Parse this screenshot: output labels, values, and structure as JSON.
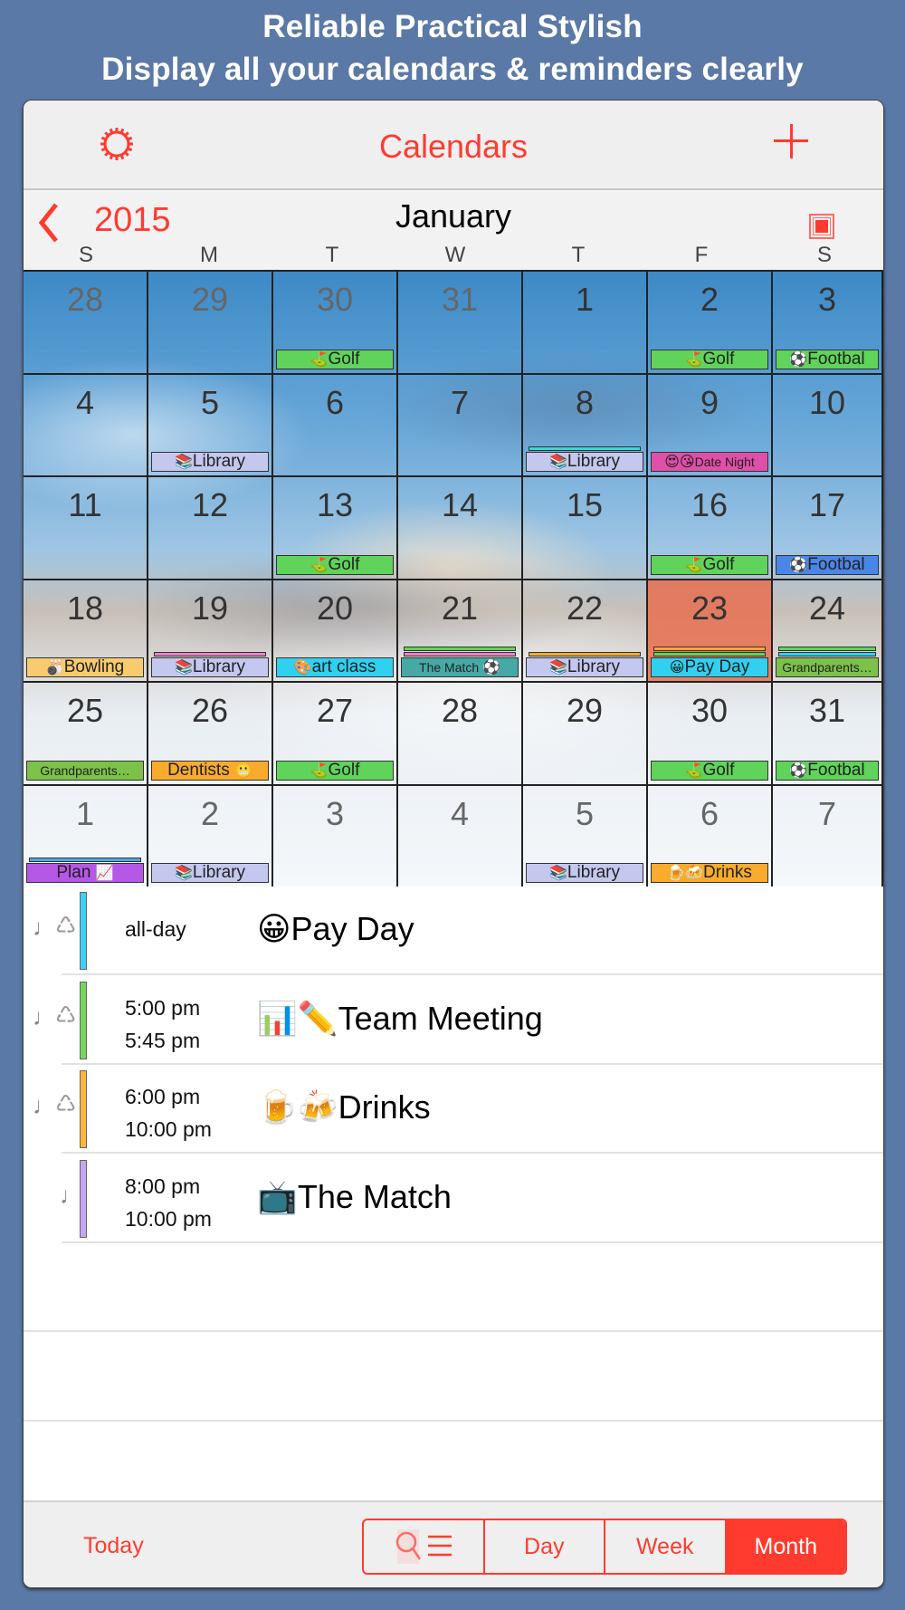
{
  "promo": {
    "line1": "Reliable Practical Stylish",
    "line2": "Display all your calendars & reminders clearly"
  },
  "navbar": {
    "settings_icon": "gear-icon",
    "title": "Calendars",
    "add_icon": "plus-icon"
  },
  "month_header": {
    "back_icon": "chevron-left-icon",
    "year": "2015",
    "month": "January",
    "view_toggle_icon": "square-icon",
    "weekdays": [
      "S",
      "M",
      "T",
      "W",
      "T",
      "F",
      "S"
    ]
  },
  "colors": {
    "accent": "#ff3b30",
    "background": "#5b79a6",
    "today_cell": "#e86e50",
    "golf": "#5fd35a",
    "library": "#c4c8ef",
    "football_green": "#5fd35a",
    "football_blue": "#4a86e8",
    "date_night": "#e04fa8",
    "bowling": "#f7cb6e",
    "art_class": "#2fd0f0",
    "the_match": "#46a9a6",
    "pay_day": "#2fd0f0",
    "grandparents": "#7cc24a",
    "dentists": "#f8ab2c",
    "plan": "#b558e6",
    "drinks": "#f8ab2c"
  },
  "calendar": {
    "weeks": [
      [
        {
          "day": "28",
          "other": true,
          "events": []
        },
        {
          "day": "29",
          "other": true,
          "events": []
        },
        {
          "day": "30",
          "other": true,
          "events": [
            {
              "icon": "⛳",
              "label": "Golf",
              "color": "#5fd35a"
            }
          ]
        },
        {
          "day": "31",
          "other": true,
          "events": []
        },
        {
          "day": "1",
          "events": []
        },
        {
          "day": "2",
          "events": [
            {
              "icon": "⛳",
              "label": "Golf",
              "color": "#5fd35a"
            }
          ]
        },
        {
          "day": "3",
          "events": [
            {
              "icon": "⚽",
              "label": "Footbal",
              "color": "#5fd35a"
            }
          ]
        }
      ],
      [
        {
          "day": "4",
          "events": []
        },
        {
          "day": "5",
          "events": [
            {
              "icon": "📚",
              "label": "Library",
              "color": "#c4c8ef"
            }
          ]
        },
        {
          "day": "6",
          "events": []
        },
        {
          "day": "7",
          "events": []
        },
        {
          "day": "8",
          "events": [
            {
              "icon": "📚",
              "label": "Library",
              "color": "#c4c8ef"
            }
          ],
          "stripes": [
            "#3dd6d0"
          ]
        },
        {
          "day": "9",
          "events": [
            {
              "icon": "😍😘",
              "label": "Date Night",
              "color": "#e04fa8",
              "small": true
            }
          ]
        },
        {
          "day": "10",
          "events": []
        }
      ],
      [
        {
          "day": "11",
          "events": []
        },
        {
          "day": "12",
          "events": []
        },
        {
          "day": "13",
          "events": [
            {
              "icon": "⛳",
              "label": "Golf",
              "color": "#5fd35a"
            }
          ]
        },
        {
          "day": "14",
          "events": []
        },
        {
          "day": "15",
          "events": []
        },
        {
          "day": "16",
          "events": [
            {
              "icon": "⛳",
              "label": "Golf",
              "color": "#5fd35a"
            }
          ]
        },
        {
          "day": "17",
          "events": [
            {
              "icon": "⚽",
              "label": "Footbal",
              "color": "#4a86e8"
            }
          ]
        }
      ],
      [
        {
          "day": "18",
          "events": [
            {
              "icon": "🎳",
              "label": "Bowling",
              "color": "#f7cb6e"
            }
          ]
        },
        {
          "day": "19",
          "events": [
            {
              "icon": "📚",
              "label": "Library",
              "color": "#c4c8ef"
            }
          ],
          "stripes": [
            "#f07ecb"
          ]
        },
        {
          "day": "20",
          "events": [
            {
              "icon": "🎨",
              "label": "art class",
              "color": "#2fd0f0"
            }
          ]
        },
        {
          "day": "21",
          "events": [
            {
              "icon": "⚽",
              "label": "The Match",
              "color": "#46a9a6",
              "small": true,
              "icon_after": true
            }
          ],
          "stripes": [
            "#f07ecb",
            "#5fd35a"
          ]
        },
        {
          "day": "22",
          "events": [
            {
              "icon": "📚",
              "label": "Library",
              "color": "#c4c8ef"
            }
          ],
          "stripes": [
            "#f8ab2c"
          ]
        },
        {
          "day": "23",
          "today": true,
          "events": [
            {
              "icon": "😀",
              "label": "Pay Day",
              "color": "#2fd0f0"
            }
          ],
          "stripes": [
            "#5fd35a",
            "#f8ab2c"
          ]
        },
        {
          "day": "24",
          "events": [
            {
              "icon": "",
              "label": "Grandparents…",
              "color": "#7cc24a",
              "small": true
            }
          ],
          "stripes": [
            "#2fd0f0",
            "#5fd35a"
          ]
        }
      ],
      [
        {
          "day": "25",
          "events": [
            {
              "icon": "",
              "label": "Grandparents…",
              "color": "#7cc24a",
              "small": true
            }
          ]
        },
        {
          "day": "26",
          "events": [
            {
              "icon": "😬",
              "label": "Dentists",
              "color": "#f8ab2c",
              "icon_after": true
            }
          ]
        },
        {
          "day": "27",
          "events": [
            {
              "icon": "⛳",
              "label": "Golf",
              "color": "#5fd35a"
            }
          ]
        },
        {
          "day": "28",
          "events": []
        },
        {
          "day": "29",
          "events": []
        },
        {
          "day": "30",
          "events": [
            {
              "icon": "⛳",
              "label": "Golf",
              "color": "#5fd35a"
            }
          ]
        },
        {
          "day": "31",
          "events": [
            {
              "icon": "⚽",
              "label": "Footbal",
              "color": "#5fd35a"
            }
          ]
        }
      ],
      [
        {
          "day": "1",
          "other": true,
          "events": [
            {
              "icon": "📈",
              "label": "Plan",
              "color": "#b558e6",
              "icon_after": true
            }
          ],
          "stripes": [
            "#4aa8e0"
          ]
        },
        {
          "day": "2",
          "other": true,
          "events": [
            {
              "icon": "📚",
              "label": "Library",
              "color": "#c4c8ef"
            }
          ]
        },
        {
          "day": "3",
          "other": true,
          "events": []
        },
        {
          "day": "4",
          "other": true,
          "events": []
        },
        {
          "day": "5",
          "other": true,
          "events": [
            {
              "icon": "📚",
              "label": "Library",
              "color": "#c4c8ef"
            }
          ]
        },
        {
          "day": "6",
          "other": true,
          "events": [
            {
              "icon": "🍺🍻",
              "label": "Drinks",
              "color": "#f8ab2c"
            }
          ]
        },
        {
          "day": "7",
          "other": true,
          "events": []
        }
      ]
    ]
  },
  "day_events": [
    {
      "alarm": "♩",
      "repeat": "♺",
      "color": "#3ed0f5",
      "allday": "all-day",
      "start": "",
      "end": "",
      "icon": "😀",
      "title": "Pay Day"
    },
    {
      "alarm": "♩",
      "repeat": "♺",
      "color": "#77d65e",
      "allday": "",
      "start": "5:00 pm",
      "end": "5:45 pm",
      "icon": "📊✏️",
      "title": "Team Meeting"
    },
    {
      "alarm": "♩",
      "repeat": "♺",
      "color": "#ffb640",
      "allday": "",
      "start": "6:00 pm",
      "end": "10:00 pm",
      "icon": "🍺🍻",
      "title": "Drinks"
    },
    {
      "alarm": "♩",
      "repeat": "",
      "color": "#c7a6f0",
      "allday": "",
      "start": "8:00 pm",
      "end": "10:00 pm",
      "icon": "📺",
      "title": "The Match"
    }
  ],
  "toolbar": {
    "today_label": "Today",
    "segments": [
      {
        "label": "",
        "icon": "search-list-icon",
        "active": false
      },
      {
        "label": "Day",
        "active": false
      },
      {
        "label": "Week",
        "active": false
      },
      {
        "label": "Month",
        "active": true
      }
    ]
  }
}
